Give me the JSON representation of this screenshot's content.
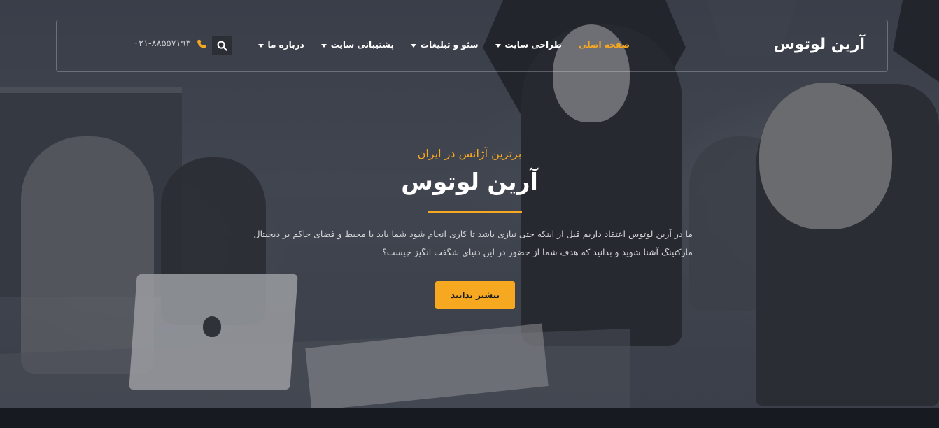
{
  "header": {
    "logo": "آرین لوتوس",
    "nav": [
      {
        "label": "صفحه اصلی",
        "active": true,
        "has_dropdown": false
      },
      {
        "label": "طراحی سایت",
        "active": false,
        "has_dropdown": true
      },
      {
        "label": "سئو و تبلیغات",
        "active": false,
        "has_dropdown": true
      },
      {
        "label": "پشتیبانی سایت",
        "active": false,
        "has_dropdown": true
      },
      {
        "label": "درباره ما",
        "active": false,
        "has_dropdown": true
      }
    ],
    "search_icon": "search-icon",
    "phone_icon": "phone-icon",
    "phone_number": "۰۲۱-۸۸۵۵۷۱۹۳"
  },
  "hero": {
    "tagline": "برترین آژانس در ایران",
    "title": "آرین لوتوس",
    "description": "ما در آرین لوتوس اعتقاد داریم قبل از اینکه حتی نیازی باشد تا کاری انجام شود شما باید با محیط و فضای حاکم بر دیجیتال مارکتینگ آشنا شوید و بدانید که هدف شما از حضور در این دنیای شگفت انگیز چیست؟",
    "cta_label": "بیشتر بدانید"
  },
  "colors": {
    "accent": "#f6a821",
    "text_light": "#ffffff",
    "overlay": "#3e424c"
  }
}
